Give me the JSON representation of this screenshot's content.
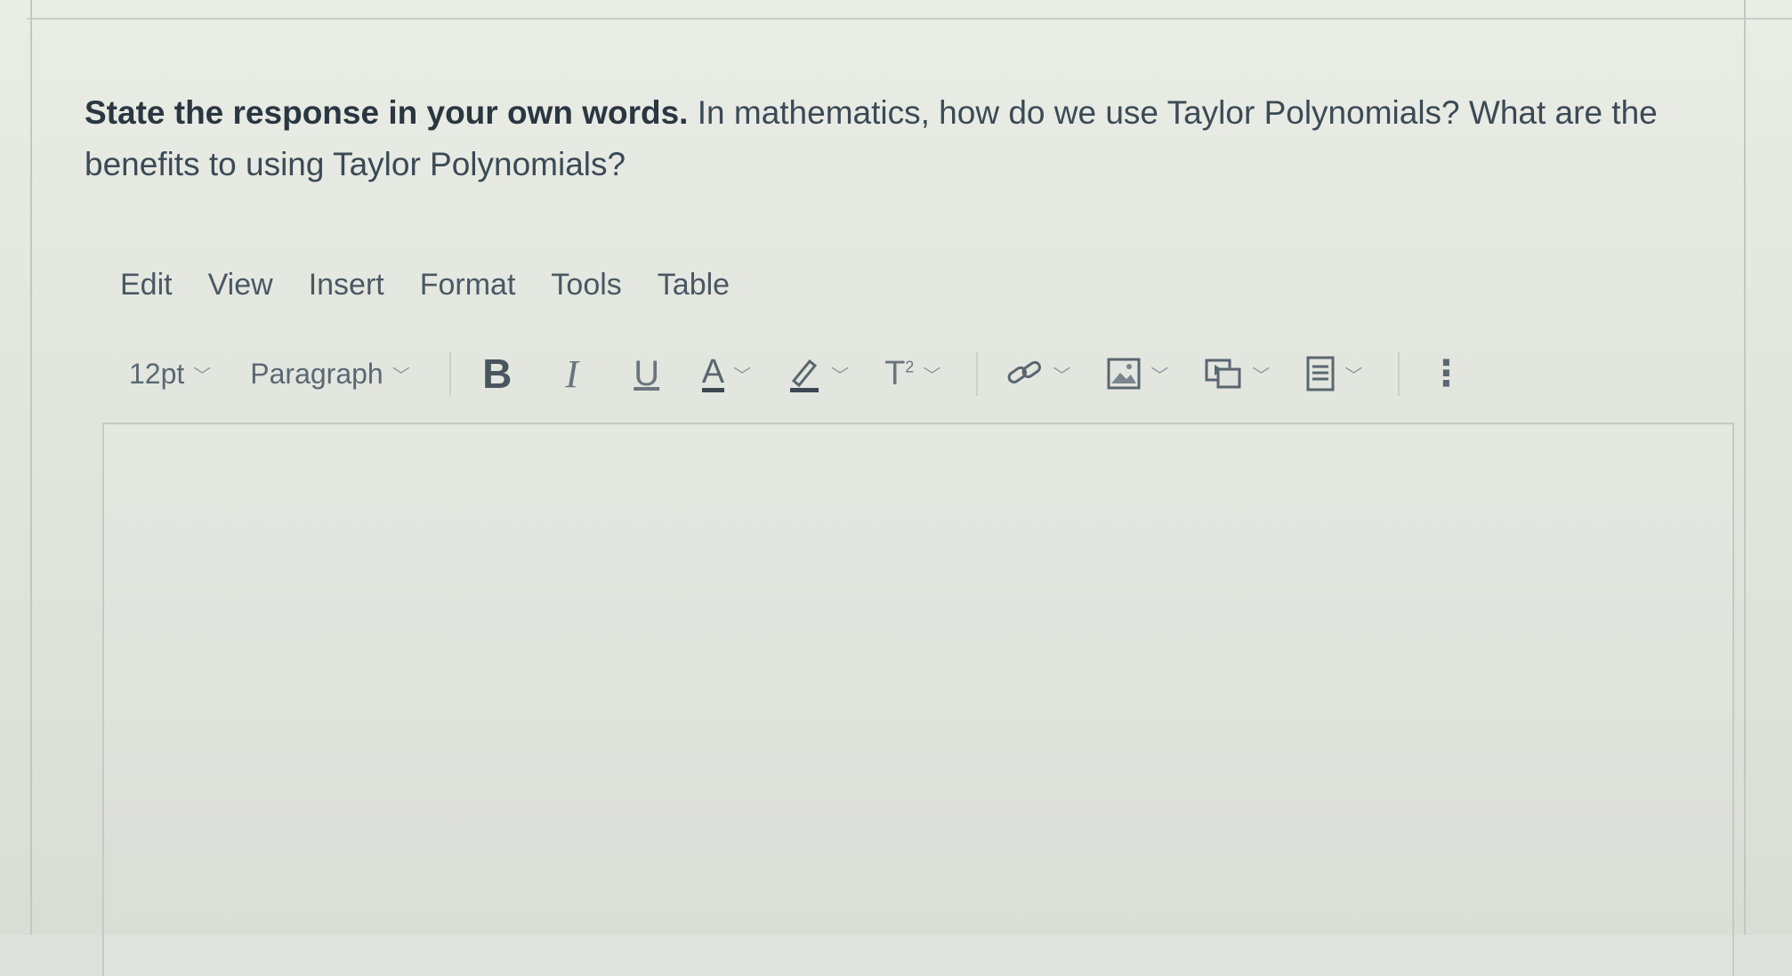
{
  "question": {
    "bold": "State the response in your own words.",
    "rest": " In mathematics, how do we use Taylor Polynomials?  What are the benefits to using Taylor Polynomials?"
  },
  "menu": [
    "Edit",
    "View",
    "Insert",
    "Format",
    "Tools",
    "Table"
  ],
  "toolbar": {
    "font_size": "12pt",
    "block_format": "Paragraph",
    "bold_label": "B",
    "italic_label": "I",
    "underline_label": "U",
    "text_color_label": "A",
    "superscript_label": "T",
    "superscript_exp": "2",
    "more_label": "⋮",
    "icons": [
      "bold-icon",
      "italic-icon",
      "underline-icon",
      "text-color-icon",
      "highlight-icon",
      "superscript-icon",
      "link-icon",
      "image-icon",
      "media-icon",
      "document-icon",
      "more-options-icon"
    ]
  },
  "editor": {
    "content": ""
  }
}
